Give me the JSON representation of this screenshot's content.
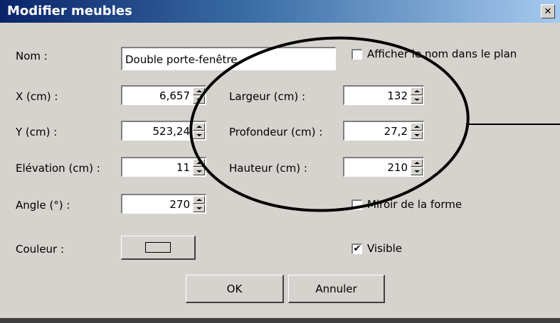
{
  "window": {
    "title": "Modifier meubles",
    "close_glyph": "✕"
  },
  "fields": {
    "name": {
      "label": "Nom :",
      "value": "Double porte-fenêtre"
    },
    "x": {
      "label": "X (cm) :",
      "value": "6,657"
    },
    "y": {
      "label": "Y (cm) :",
      "value": "523,24"
    },
    "elevation": {
      "label": "Elévation (cm) :",
      "value": "11"
    },
    "angle": {
      "label": "Angle (°) :",
      "value": "270"
    },
    "width": {
      "label": "Largeur (cm) :",
      "value": "132"
    },
    "depth": {
      "label": "Profondeur (cm) :",
      "value": "27,2"
    },
    "height": {
      "label": "Hauteur (cm) :",
      "value": "210"
    },
    "color": {
      "label": "Couleur :"
    }
  },
  "checkboxes": {
    "show_name": {
      "label": "Afficher le nom dans le plan",
      "checked": false,
      "mark": ""
    },
    "mirror": {
      "label": "Miroir de la forme",
      "checked": false,
      "mark": ""
    },
    "visible": {
      "label": "Visible",
      "checked": true,
      "mark": "✔"
    }
  },
  "buttons": {
    "ok": "OK",
    "cancel": "Annuler"
  },
  "colors": {
    "title_start": "#0a246a",
    "title_end": "#a6caf0",
    "face": "#d6d3ce"
  },
  "icons": [
    "close-icon",
    "spin-up-arrow-icon",
    "spin-down-arrow-icon",
    "checkmark-icon",
    "color-swatch-icon"
  ]
}
